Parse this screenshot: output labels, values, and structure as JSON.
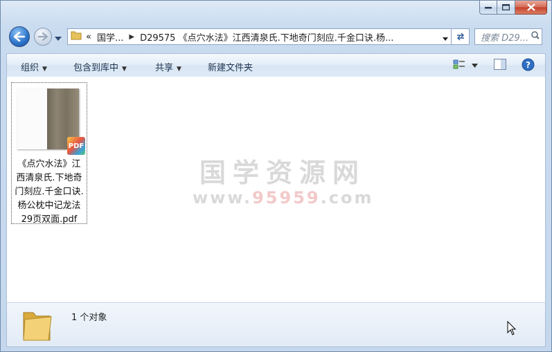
{
  "nav": {
    "address_path": [
      "国学...",
      "D29575 《点穴水法》江西清泉氏.下地奇门刻应.千金口诀.杨..."
    ],
    "overflow_label": "«",
    "search_placeholder": "搜索 D29..."
  },
  "toolbar": {
    "organize_label": "组织",
    "include_label": "包含到库中",
    "share_label": "共享",
    "new_folder_label": "新建文件夹"
  },
  "files": [
    {
      "name_lines": [
        "《点穴水法》江",
        "西清泉氏.下地奇",
        "门刻应.千金口诀.",
        "杨公枕中记龙法",
        "29页双面.pdf"
      ],
      "badge": "PDF",
      "icon": "pdf-thumbnail-icon"
    }
  ],
  "watermark": {
    "text": "国学资源网",
    "url_prefix": "www.",
    "url_highlight": "95959",
    "url_suffix": ".com"
  },
  "status": {
    "item_count": "1 个对象"
  },
  "colors": {
    "accent": "#2b73c9",
    "close_button": "#c3412b",
    "command_text": "#1e3450"
  }
}
